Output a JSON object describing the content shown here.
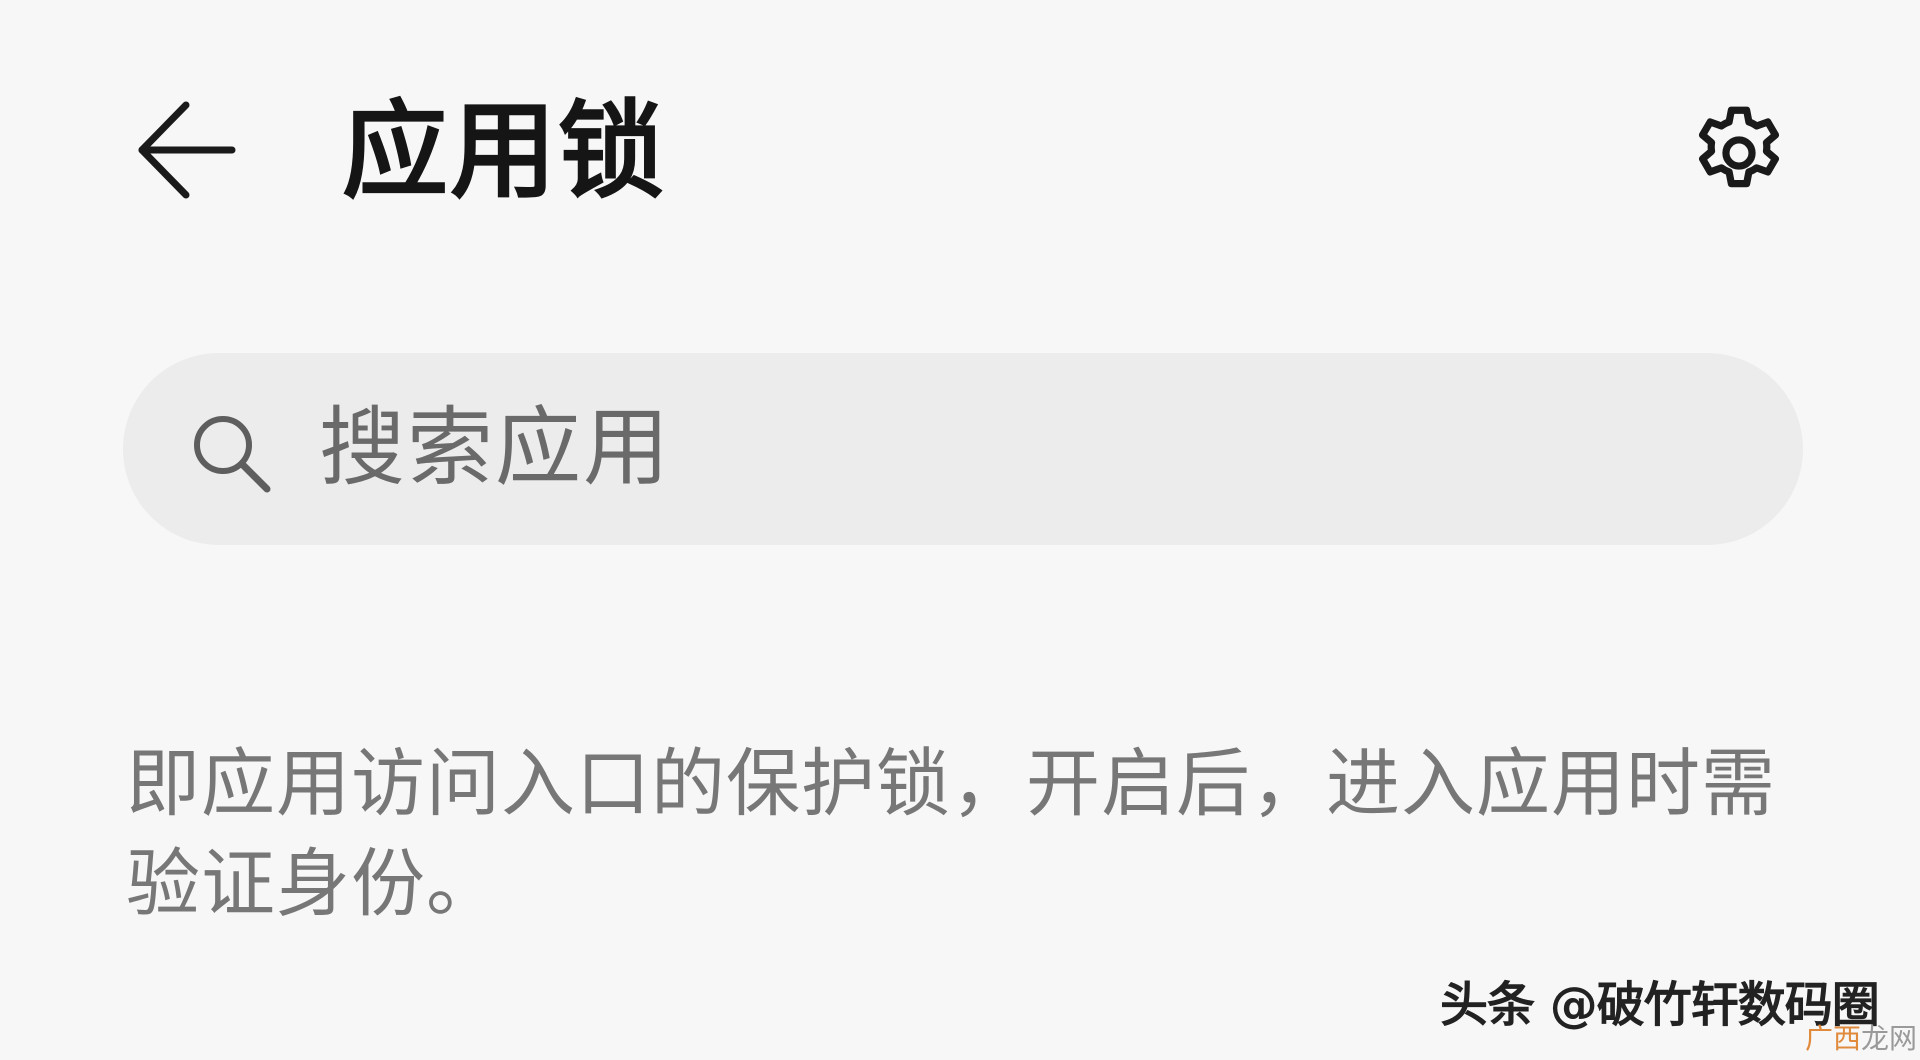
{
  "header": {
    "title": "应用锁",
    "back_icon": "arrow-left-icon",
    "settings_icon": "gear-icon"
  },
  "search": {
    "placeholder": "搜索应用",
    "icon": "search-icon"
  },
  "description": {
    "text": "即应用访问入口的保护锁，开启后，进入应用时需验证身份。"
  },
  "watermark": {
    "text": "头条 @破竹轩数码圈",
    "corner_accent": "广西",
    "corner_rest": "龙网"
  },
  "colors": {
    "background": "#f7f7f7",
    "search_bg": "#ececec",
    "title": "#151515",
    "secondary_text": "#777777"
  }
}
